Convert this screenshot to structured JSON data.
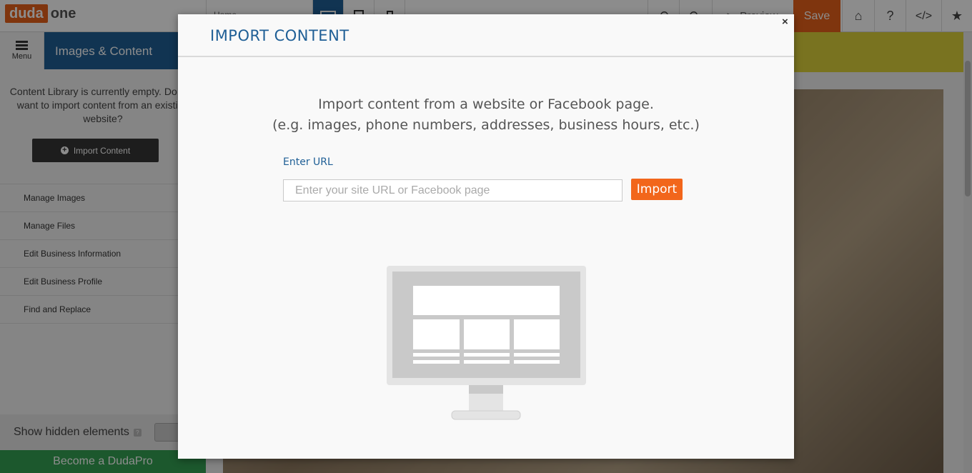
{
  "topbar": {
    "logo_left": "duda",
    "logo_right": "one",
    "page_select": "Home",
    "preview_label": "Preview",
    "save_label": "Save"
  },
  "sidebar": {
    "menu_label": "Menu",
    "panel_title": "Images & Content",
    "library_message": "Content Library is currently empty. Do you want to import content from an existing website?",
    "import_button": "Import Content",
    "items": [
      {
        "label": "Manage Images"
      },
      {
        "label": "Manage Files"
      },
      {
        "label": "Edit Business Information"
      },
      {
        "label": "Edit Business Profile"
      },
      {
        "label": "Find and Replace"
      }
    ],
    "hidden_elements_label": "Show hidden elements",
    "hidden_help": "?",
    "become_pro": "Become a DudaPro"
  },
  "modal": {
    "title": "IMPORT CONTENT",
    "close": "×",
    "desc_line1": "Import content from a website or Facebook page.",
    "desc_line2": "(e.g. images, phone numbers, addresses, business hours, etc.)",
    "url_label": "Enter URL",
    "url_placeholder": "Enter your site URL or Facebook page",
    "url_value": "",
    "import_button": "Import"
  },
  "colors": {
    "brand_orange": "#e8611a",
    "brand_blue": "#1f5f96",
    "pro_green": "#33a152",
    "banner_yellow": "#ddd23b"
  },
  "icons": [
    "hamburger-icon",
    "desktop-icon",
    "tablet-icon",
    "mobile-icon",
    "undo-icon",
    "redo-icon",
    "play-icon",
    "home-icon",
    "help-icon",
    "code-icon",
    "star-icon",
    "plus-circle-icon",
    "close-icon",
    "monitor-illustration"
  ]
}
